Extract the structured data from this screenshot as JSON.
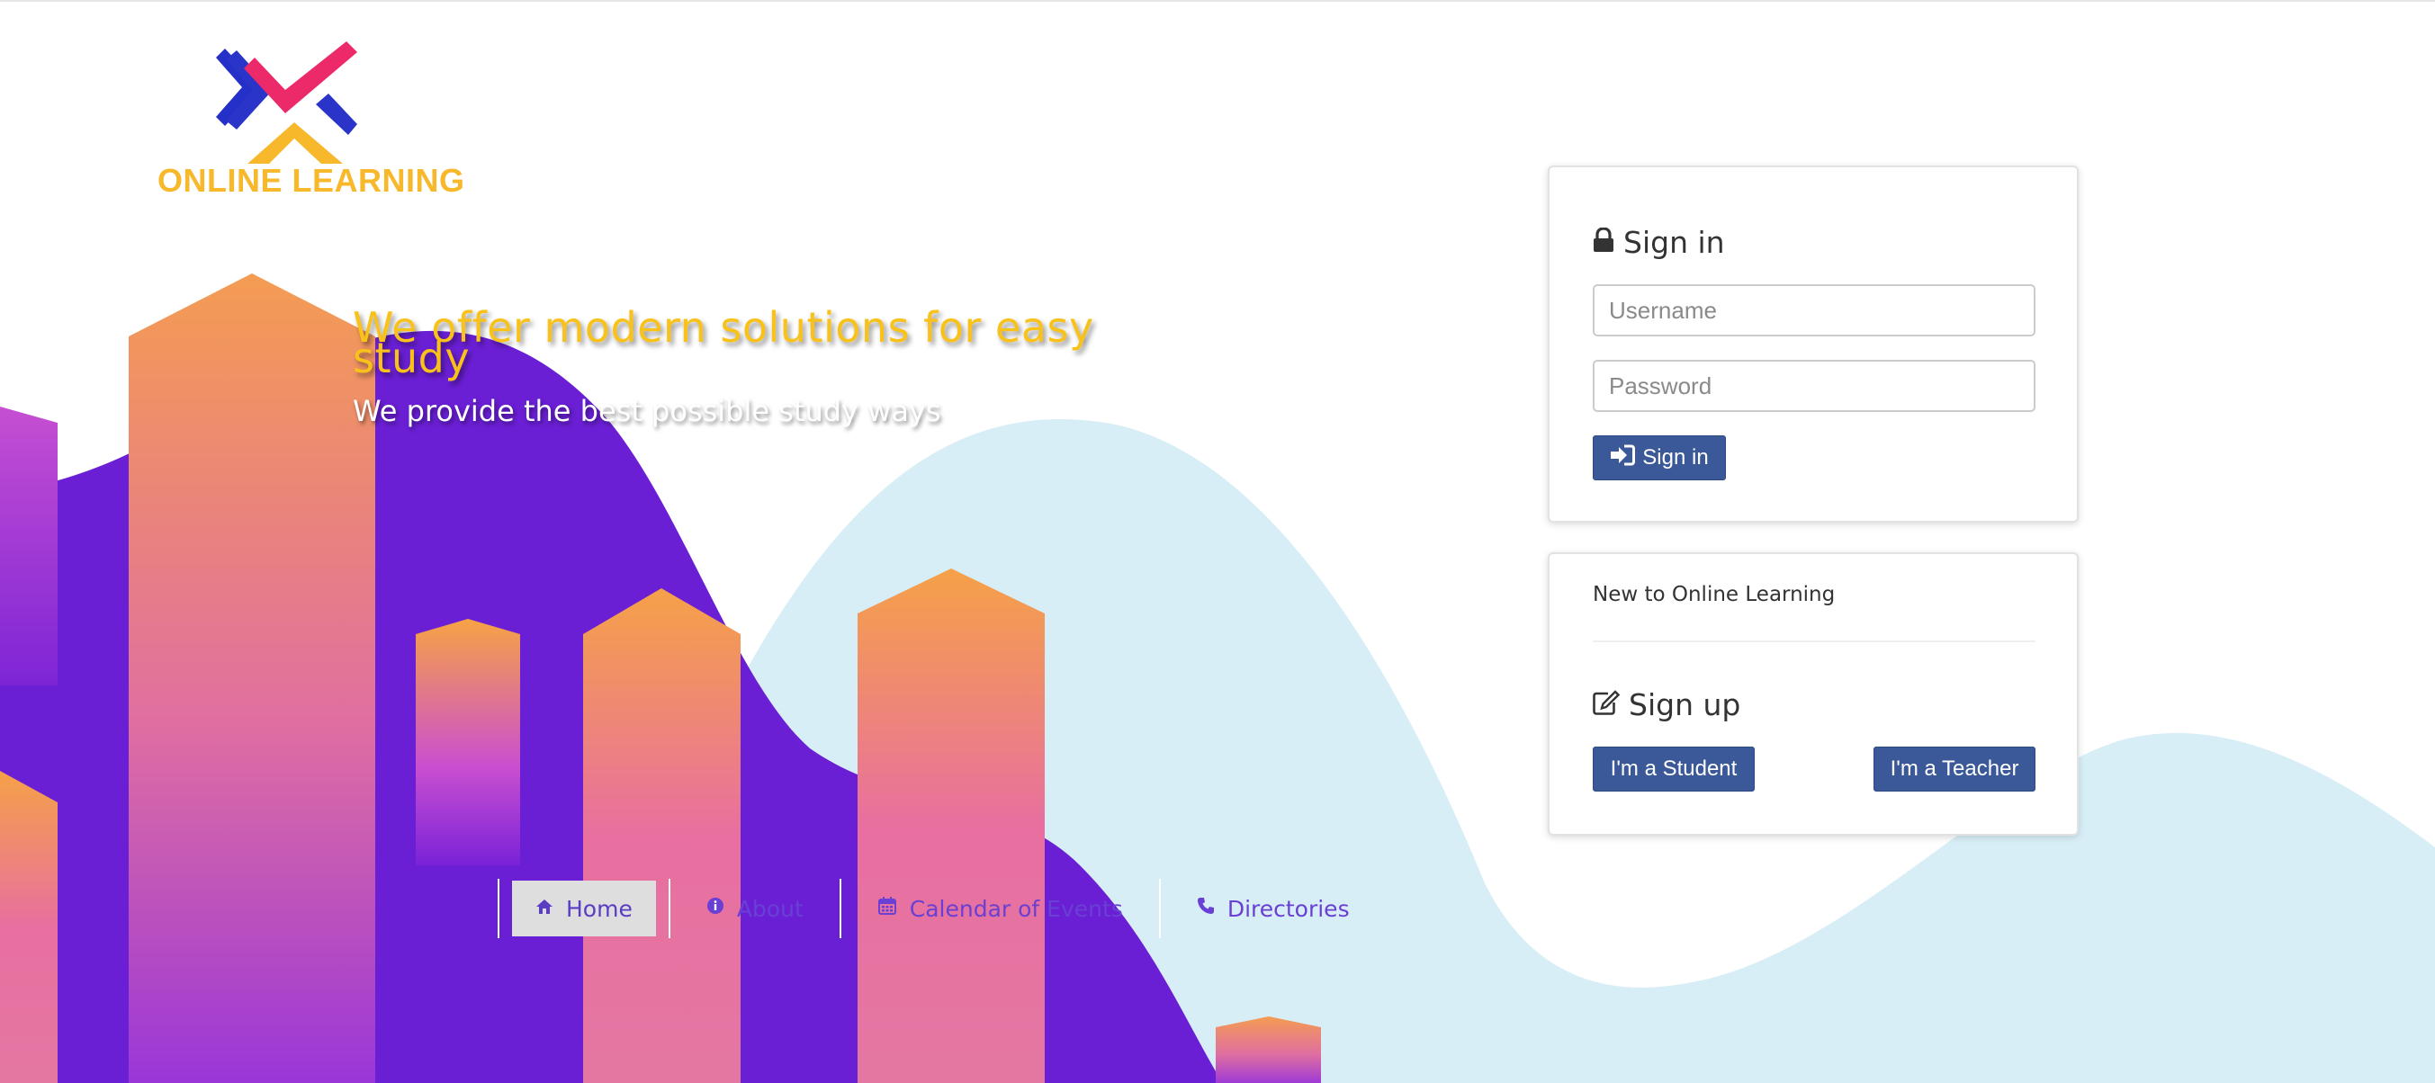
{
  "brand": {
    "name": "ONLINE LEARNING",
    "logo_icon": "x-logo-icon"
  },
  "hero": {
    "headline": "We offer modern solutions for easy study",
    "subheadline": "We provide the best possible study ways"
  },
  "nav": {
    "items": [
      {
        "label": "Home",
        "icon": "home-icon",
        "active": true
      },
      {
        "label": "About",
        "icon": "info-icon",
        "active": false
      },
      {
        "label": "Calendar of Events",
        "icon": "calendar-icon",
        "active": false
      },
      {
        "label": "Directories",
        "icon": "phone-icon",
        "active": false
      }
    ]
  },
  "signin": {
    "title": "Sign in",
    "title_icon": "lock-icon",
    "username_placeholder": "Username",
    "username_value": "",
    "password_placeholder": "Password",
    "password_value": "",
    "button_label": "Sign in",
    "button_icon": "sign-in-icon"
  },
  "signup": {
    "intro": "New to Online Learning",
    "title": "Sign up",
    "title_icon": "edit-icon",
    "student_button": "I'm a Student",
    "teacher_button": "I'm a Teacher"
  },
  "colors": {
    "primary_button": "#3b5998",
    "accent_yellow": "#f9c21b",
    "purple": "#6a1fd4",
    "light_blue": "#d8eef6",
    "nav_text": "#6a3fd3"
  }
}
